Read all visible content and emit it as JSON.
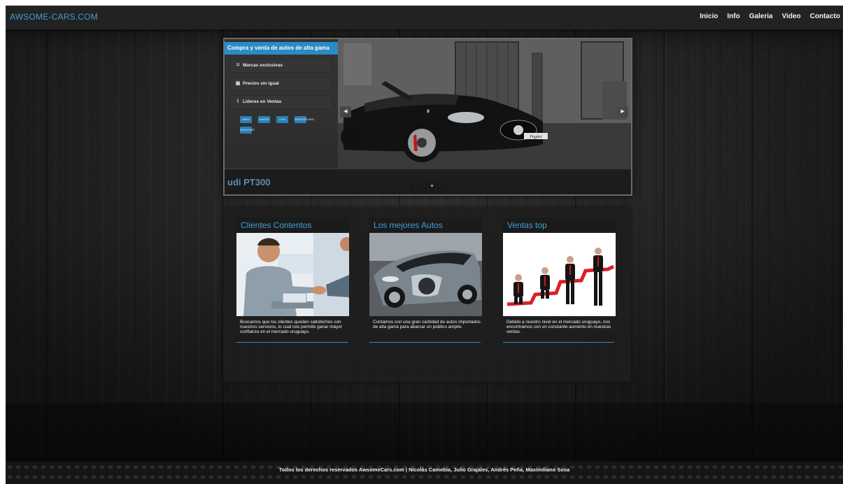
{
  "header": {
    "brand": "AWSOME-CARS.COM",
    "nav": [
      "Inicio",
      "Info",
      "Galeria",
      "Video",
      "Contacto"
    ]
  },
  "slider": {
    "panel_title": "Compra y venta de autos de alta gama",
    "features": [
      {
        "label": "Marcas exclusivas",
        "icon": "bookmark-icon"
      },
      {
        "label": "Precios sin igual",
        "icon": "money-icon"
      },
      {
        "label": "Lideres en Ventas",
        "icon": "chart-icon"
      }
    ],
    "payment_cards": [
      "AMEX",
      "DINERS",
      "VISA",
      "MASTERCARD",
      "DISCOVER"
    ],
    "caption": "udi PT300",
    "prev_icon": "chevron-left-icon",
    "next_icon": "chevron-right-icon",
    "pause_icon": "pause-icon",
    "dots_count": 4,
    "active_dot": 2
  },
  "columns": [
    {
      "title": "Clientes Contentos",
      "text": "Buscamos que los clientes queden satisfechos con nuestros servicios, lo cual nos permite ganar mayor confianza en el mercado uruguayo.",
      "image": "handshake-photo"
    },
    {
      "title": "Los mejores Autos",
      "text": "Contamos con una gran cantidad de autos importados de alta gama para abarcar un público amplio.",
      "image": "sports-car-photo"
    },
    {
      "title": "Ventas top",
      "text": "Debido a nuestro nivel en el mercado uruguayo, nos encontramos con un constante aumento en nuestras ventas.",
      "image": "business-growth-photo"
    }
  ],
  "footer": {
    "text": "Todos los derechos reservados AwsomeCars.com | Nicolás Camebia, Julio Grajales, Andrés Peña, Maximiliano Sosa"
  },
  "colors": {
    "accent": "#2b8bc4",
    "brand_text": "#3d9fd9",
    "background": "#1e1e1e",
    "dot_active": "#e3a521"
  }
}
